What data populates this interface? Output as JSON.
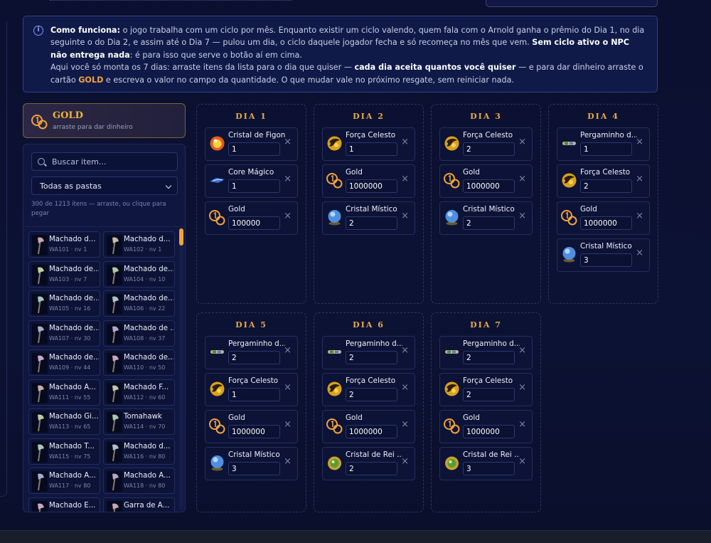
{
  "info": {
    "title": "Como funciona:",
    "text1": " o jogo trabalha com um ciclo por mês. Enquanto existir um ciclo valendo, quem fala com o Arnold ganha o prêmio do Dia 1, no dia seguinte o do Dia 2, e assim até o Dia 7 — pulou um dia, o ciclo daquele jogador fecha e só recomeça no mês que vem. ",
    "bold1": "Sem ciclo ativo o NPC não entrega nada",
    "text2": ": é para isso que serve o botão aí em cima.",
    "text3": "Aqui você só monta os 7 dias: arraste itens da lista para o dia que quiser — ",
    "bold2": "cada dia aceita quantos você quiser",
    "text4": " — e para dar dinheiro arraste o cartão ",
    "gold_word": "GOLD",
    "text5": " e escreva o valor no campo da quantidade. O que mudar vale no próximo resgate, sem reiniciar nada."
  },
  "gold_card": {
    "name": "GOLD",
    "subtitle": "arraste para dar dinheiro"
  },
  "search": {
    "placeholder": "Buscar item..."
  },
  "folder_select": {
    "value": "Todas as pastas"
  },
  "count_text": "300 de 1213 itens — arraste, ou clique para pegar",
  "items": [
    {
      "name": "Machado d...",
      "meta": "WA101 · nv 1"
    },
    {
      "name": "Machado d...",
      "meta": "WA102 · nv 1"
    },
    {
      "name": "Machado de...",
      "meta": "WA103 · nv 7"
    },
    {
      "name": "Machado de...",
      "meta": "WA104 · nv 10"
    },
    {
      "name": "Machado de...",
      "meta": "WA105 · nv 16"
    },
    {
      "name": "Machado de...",
      "meta": "WA106 · nv 22"
    },
    {
      "name": "Machado de...",
      "meta": "WA107 · nv 30"
    },
    {
      "name": "Machado de ...",
      "meta": "WA108 · nv 37"
    },
    {
      "name": "Machado de...",
      "meta": "WA109 · nv 44"
    },
    {
      "name": "Machado de...",
      "meta": "WA110 · nv 50"
    },
    {
      "name": "Machado A...",
      "meta": "WA111 · nv 55"
    },
    {
      "name": "Machado F...",
      "meta": "WA112 · nv 60"
    },
    {
      "name": "Machado Gi...",
      "meta": "WA113 · nv 65"
    },
    {
      "name": "Tomahawk",
      "meta": "WA114 · nv 70"
    },
    {
      "name": "Machado T...",
      "meta": "WA115 · nv 75"
    },
    {
      "name": "Machado d...",
      "meta": "WA116 · nv 80"
    },
    {
      "name": "Machado A...",
      "meta": "WA117 · nv 80"
    },
    {
      "name": "Machado A...",
      "meta": "WA118 · nv 80"
    },
    {
      "name": "Machado E...",
      "meta": ""
    },
    {
      "name": "Garra de Á...",
      "meta": ""
    }
  ],
  "days": [
    {
      "title": "DIA 1",
      "slots": [
        {
          "name": "Cristal de Figon",
          "qty": "1",
          "icon": "fire-crystal-icon"
        },
        {
          "name": "Core Mágico",
          "qty": "1",
          "icon": "magic-core-icon"
        },
        {
          "name": "Gold",
          "qty": "100000",
          "icon": "gold-coin-icon"
        }
      ]
    },
    {
      "title": "DIA 2",
      "slots": [
        {
          "name": "Força Celesto",
          "qty": "1",
          "icon": "celestial-force-icon"
        },
        {
          "name": "Gold",
          "qty": "1000000",
          "icon": "gold-coin-icon"
        },
        {
          "name": "Cristal Místico",
          "qty": "2",
          "icon": "mystic-crystal-icon"
        }
      ]
    },
    {
      "title": "DIA 3",
      "slots": [
        {
          "name": "Força Celesto",
          "qty": "2",
          "icon": "celestial-force-icon"
        },
        {
          "name": "Gold",
          "qty": "1000000",
          "icon": "gold-coin-icon"
        },
        {
          "name": "Cristal Místico",
          "qty": "2",
          "icon": "mystic-crystal-icon"
        }
      ]
    },
    {
      "title": "DIA 4",
      "slots": [
        {
          "name": "Pergaminho d...",
          "qty": "1",
          "icon": "scroll-icon"
        },
        {
          "name": "Força Celesto",
          "qty": "2",
          "icon": "celestial-force-icon"
        },
        {
          "name": "Gold",
          "qty": "1000000",
          "icon": "gold-coin-icon"
        },
        {
          "name": "Cristal Místico",
          "qty": "3",
          "icon": "mystic-crystal-icon"
        }
      ]
    },
    {
      "title": "DIA 5",
      "slots": [
        {
          "name": "Pergaminho d...",
          "qty": "2",
          "icon": "scroll-icon"
        },
        {
          "name": "Força Celesto",
          "qty": "1",
          "icon": "celestial-force-icon"
        },
        {
          "name": "Gold",
          "qty": "1000000",
          "icon": "gold-coin-icon"
        },
        {
          "name": "Cristal Místico",
          "qty": "3",
          "icon": "mystic-crystal-icon"
        }
      ]
    },
    {
      "title": "DIA 6",
      "slots": [
        {
          "name": "Pergaminho d...",
          "qty": "2",
          "icon": "scroll-icon"
        },
        {
          "name": "Força Celesto",
          "qty": "2",
          "icon": "celestial-force-icon"
        },
        {
          "name": "Gold",
          "qty": "1000000",
          "icon": "gold-coin-icon"
        },
        {
          "name": "Cristal de Rei ...",
          "qty": "2",
          "icon": "king-crystal-icon"
        }
      ]
    },
    {
      "title": "DIA 7",
      "slots": [
        {
          "name": "Pergaminho d...",
          "qty": "2",
          "icon": "scroll-icon"
        },
        {
          "name": "Força Celesto",
          "qty": "2",
          "icon": "celestial-force-icon"
        },
        {
          "name": "Gold",
          "qty": "1000000",
          "icon": "gold-coin-icon"
        },
        {
          "name": "Cristal de Rei ...",
          "qty": "3",
          "icon": "king-crystal-icon"
        }
      ]
    }
  ],
  "remove_glyph": "×",
  "colors": {
    "accent": "#f2a23a",
    "day_title": "#e8a94a",
    "info_bg": "#101a48"
  }
}
